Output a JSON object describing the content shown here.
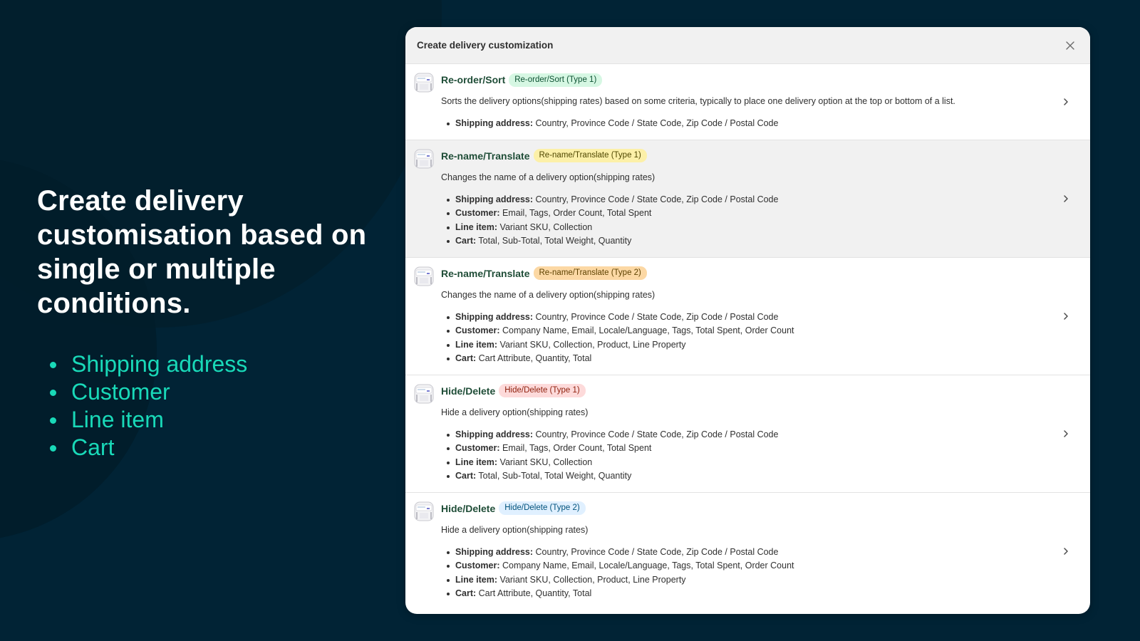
{
  "hero": {
    "title": "Create delivery customisation based on single or multiple conditions.",
    "conditions": [
      "Shipping address",
      "Customer",
      "Line item",
      "Cart"
    ]
  },
  "modal": {
    "title": "Create delivery customization",
    "close_icon": "close-icon",
    "options": [
      {
        "name": "Re-order/Sort",
        "badge": "Re-order/Sort (Type 1)",
        "badge_bg": "#d6f7e3",
        "badge_fg": "#0c5132",
        "description": "Sorts the delivery options(shipping rates) based on some criteria, typically to place one delivery option at the top or bottom of a list.",
        "conditions": [
          {
            "label": "Shipping address:",
            "value": "Country, Province Code / State Code, Zip Code / Postal Code"
          }
        ]
      },
      {
        "name": "Re-name/Translate",
        "badge": "Re-name/Translate (Type 1)",
        "badge_bg": "#fcf0a8",
        "badge_fg": "#4f4700",
        "description": "Changes the name of a delivery option(shipping rates)",
        "hovered": true,
        "conditions": [
          {
            "label": "Shipping address:",
            "value": "Country, Province Code / State Code, Zip Code / Postal Code"
          },
          {
            "label": "Customer:",
            "value": "Email, Tags, Order Count, Total Spent"
          },
          {
            "label": "Line item:",
            "value": "Variant SKU, Collection"
          },
          {
            "label": "Cart:",
            "value": "Total, Sub-Total, Total Weight, Quantity"
          }
        ]
      },
      {
        "name": "Re-name/Translate",
        "badge": "Re-name/Translate (Type 2)",
        "badge_bg": "#fcd8a4",
        "badge_fg": "#5e4200",
        "description": "Changes the name of a delivery option(shipping rates)",
        "conditions": [
          {
            "label": "Shipping address:",
            "value": "Country, Province Code / State Code, Zip Code / Postal Code"
          },
          {
            "label": "Customer:",
            "value": "Company Name, Email, Locale/Language, Tags, Total Spent, Order Count"
          },
          {
            "label": "Line item:",
            "value": "Variant SKU, Collection, Product, Line Property"
          },
          {
            "label": "Cart:",
            "value": "Cart Attribute, Quantity, Total"
          }
        ]
      },
      {
        "name": "Hide/Delete",
        "badge": "Hide/Delete (Type 1)",
        "badge_bg": "#fddada",
        "badge_fg": "#8e1f0b",
        "description": "Hide a delivery option(shipping rates)",
        "conditions": [
          {
            "label": "Shipping address:",
            "value": "Country, Province Code / State Code, Zip Code / Postal Code"
          },
          {
            "label": "Customer:",
            "value": "Email, Tags, Order Count, Total Spent"
          },
          {
            "label": "Line item:",
            "value": "Variant SKU, Collection"
          },
          {
            "label": "Cart:",
            "value": "Total, Sub-Total, Total Weight, Quantity"
          }
        ]
      },
      {
        "name": "Hide/Delete",
        "badge": "Hide/Delete (Type 2)",
        "badge_bg": "#e0f0ff",
        "badge_fg": "#00527c",
        "description": "Hide a delivery option(shipping rates)",
        "conditions": [
          {
            "label": "Shipping address:",
            "value": "Country, Province Code / State Code, Zip Code / Postal Code"
          },
          {
            "label": "Customer:",
            "value": "Company Name, Email, Locale/Language, Tags, Total Spent, Order Count"
          },
          {
            "label": "Line item:",
            "value": "Variant SKU, Collection, Product, Line Property"
          },
          {
            "label": "Cart:",
            "value": "Cart Attribute, Quantity, Total"
          }
        ]
      }
    ]
  }
}
